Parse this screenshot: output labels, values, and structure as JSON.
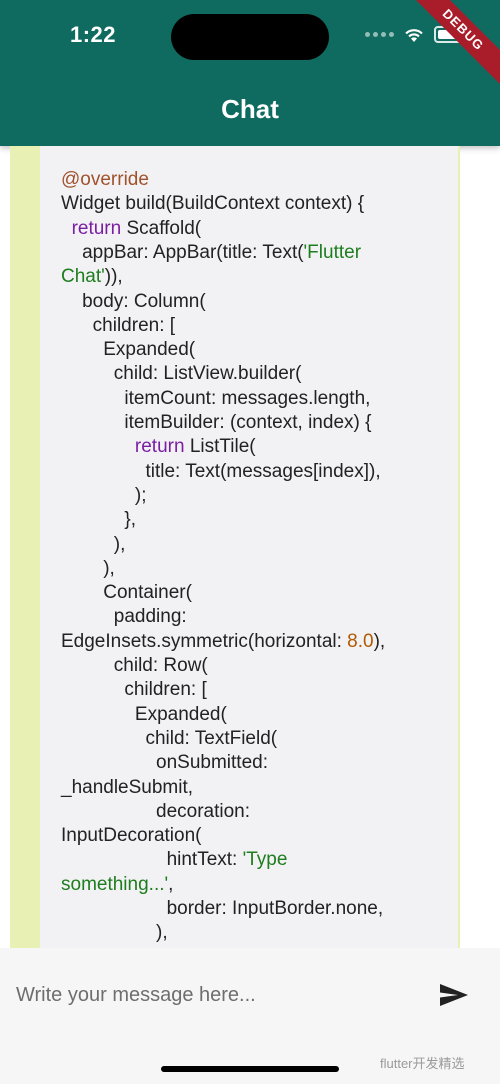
{
  "status_bar": {
    "time": "1:22",
    "debug_banner": "DEBUG"
  },
  "app_bar": {
    "title": "Chat"
  },
  "code_block": {
    "lines": [
      [
        {
          "t": "@override",
          "c": "ann"
        }
      ],
      [
        {
          "t": "Widget build(BuildContext context) {",
          "c": ""
        }
      ],
      [
        {
          "t": "  ",
          "c": ""
        },
        {
          "t": "return",
          "c": "kw"
        },
        {
          "t": " Scaffold(",
          "c": ""
        }
      ],
      [
        {
          "t": "    appBar: AppBar(title: Text(",
          "c": ""
        },
        {
          "t": "'Flutter",
          "c": "str"
        }
      ],
      [
        {
          "t": "Chat'",
          "c": "str"
        },
        {
          "t": ")),",
          "c": ""
        }
      ],
      [
        {
          "t": "    body: Column(",
          "c": ""
        }
      ],
      [
        {
          "t": "      children: [",
          "c": ""
        }
      ],
      [
        {
          "t": "        Expanded(",
          "c": ""
        }
      ],
      [
        {
          "t": "          child: ListView.builder(",
          "c": ""
        }
      ],
      [
        {
          "t": "            itemCount: messages.length,",
          "c": ""
        }
      ],
      [
        {
          "t": "            itemBuilder: (context, index) {",
          "c": ""
        }
      ],
      [
        {
          "t": "              ",
          "c": ""
        },
        {
          "t": "return",
          "c": "kw"
        },
        {
          "t": " ListTile(",
          "c": ""
        }
      ],
      [
        {
          "t": "                title: Text(messages[index]),",
          "c": ""
        }
      ],
      [
        {
          "t": "              );",
          "c": ""
        }
      ],
      [
        {
          "t": "            },",
          "c": ""
        }
      ],
      [
        {
          "t": "          ),",
          "c": ""
        }
      ],
      [
        {
          "t": "        ),",
          "c": ""
        }
      ],
      [
        {
          "t": "        Container(",
          "c": ""
        }
      ],
      [
        {
          "t": "          padding:",
          "c": ""
        }
      ],
      [
        {
          "t": "EdgeInsets.symmetric(horizontal: ",
          "c": ""
        },
        {
          "t": "8.0",
          "c": "num"
        },
        {
          "t": "),",
          "c": ""
        }
      ],
      [
        {
          "t": "          child: Row(",
          "c": ""
        }
      ],
      [
        {
          "t": "            children: [",
          "c": ""
        }
      ],
      [
        {
          "t": "              Expanded(",
          "c": ""
        }
      ],
      [
        {
          "t": "                child: TextField(",
          "c": ""
        }
      ],
      [
        {
          "t": "                  onSubmitted:",
          "c": ""
        }
      ],
      [
        {
          "t": "_handleSubmit,",
          "c": ""
        }
      ],
      [
        {
          "t": "                  decoration:",
          "c": ""
        }
      ],
      [
        {
          "t": "InputDecoration(",
          "c": ""
        }
      ],
      [
        {
          "t": "                    hintText: ",
          "c": ""
        },
        {
          "t": "'Type",
          "c": "str"
        }
      ],
      [
        {
          "t": "something...'",
          "c": "str"
        },
        {
          "t": ",",
          "c": ""
        }
      ],
      [
        {
          "t": "                    border: InputBorder.none,",
          "c": ""
        }
      ],
      [
        {
          "t": "                  ),",
          "c": ""
        }
      ],
      [
        {
          "t": "                ),",
          "c": ""
        }
      ]
    ]
  },
  "input": {
    "placeholder": "Write your message here..."
  },
  "watermark": "flutter开发精选",
  "colors": {
    "app_bar": "#0f6b5f",
    "bubble_border": "#e8f1b3",
    "code_bg": "#f2f2f4",
    "keyword": "#7a1fa2",
    "string": "#1e7d1e",
    "number": "#b05a00",
    "annotation": "#a0522d",
    "debug_banner": "#a91d2b"
  },
  "icons": [
    "signal-dots-icon",
    "wifi-icon",
    "battery-icon",
    "send-icon"
  ]
}
